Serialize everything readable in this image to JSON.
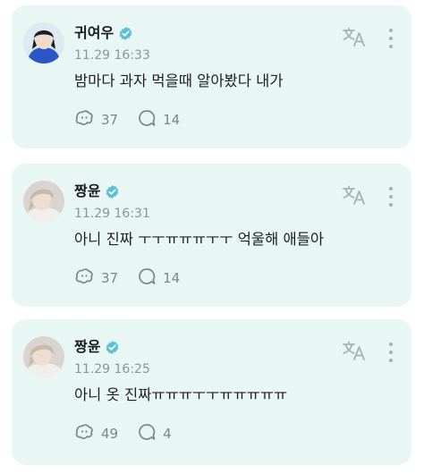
{
  "colors": {
    "card_background": "#e8f7f3",
    "verified_badge": "#5bc0d6",
    "muted_text": "#8a9893"
  },
  "posts": [
    {
      "username": "귀여우",
      "timestamp": "11.29 16:33",
      "text": "밤마다 과자 먹을때 알아봤다 내가",
      "reaction_count": "37",
      "comment_count": "14"
    },
    {
      "username": "짱윤",
      "timestamp": "11.29 16:31",
      "text": "아니 진짜 ㅜㅜㅠㅠㅠㅜㅜ 억울해 애들아",
      "reaction_count": "37",
      "comment_count": "14"
    },
    {
      "username": "짱윤",
      "timestamp": "11.29 16:25",
      "text": "아니 옷 진짜ㅠㅠㅠㅜㅜㅠㅠㅠㅠㅠ",
      "reaction_count": "49",
      "comment_count": "4"
    }
  ]
}
